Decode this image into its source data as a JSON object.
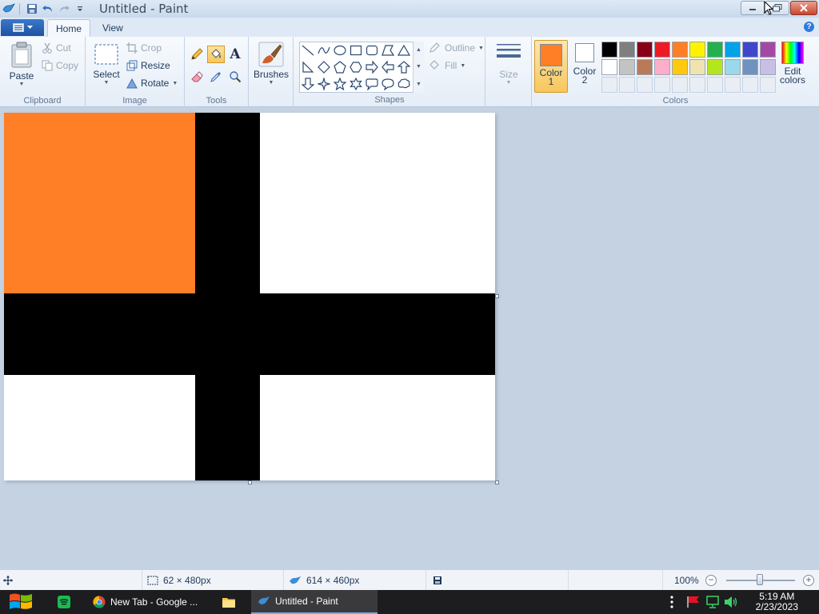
{
  "window": {
    "title": "Untitled - Paint"
  },
  "tabs": {
    "home": "Home",
    "view": "View"
  },
  "clipboard": {
    "paste": "Paste",
    "cut": "Cut",
    "copy": "Copy",
    "group_label": "Clipboard"
  },
  "image": {
    "select": "Select",
    "crop": "Crop",
    "resize": "Resize",
    "rotate": "Rotate",
    "group_label": "Image"
  },
  "tools": {
    "group_label": "Tools",
    "active_tool": "fill-with-color"
  },
  "brushes": {
    "label": "Brushes"
  },
  "shapes": {
    "outline": "Outline",
    "fill": "Fill",
    "group_label": "Shapes"
  },
  "size": {
    "label": "Size"
  },
  "colors": {
    "color1_label_line1": "Color",
    "color1_label_line2": "1",
    "color2_label_line1": "Color",
    "color2_label_line2": "2",
    "color1_value": "#ff7f27",
    "color2_value": "#ffffff",
    "edit_line1": "Edit",
    "edit_line2": "colors",
    "group_label": "Colors",
    "palette_row1": [
      "#000000",
      "#7f7f7f",
      "#880015",
      "#ed1c24",
      "#ff7f27",
      "#fff200",
      "#22b14c",
      "#00a2e8",
      "#3f48cc",
      "#a349a4"
    ],
    "palette_row2": [
      "#ffffff",
      "#c3c3c3",
      "#b97a57",
      "#ffaec9",
      "#ffc90e",
      "#efe4b0",
      "#b5e61d",
      "#99d9ea",
      "#7092be",
      "#c8bfe7"
    ]
  },
  "canvas_colors": {
    "orange": "#ff7f27",
    "black": "#000000",
    "white": "#ffffff"
  },
  "statusbar": {
    "selection_size": "62 × 480px",
    "image_size": "614 × 460px",
    "zoom": "100%"
  },
  "taskbar": {
    "chrome_label": "New Tab - Google ...",
    "paint_label": "Untitled - Paint",
    "time": "5:19 AM",
    "date": "2/23/2023"
  }
}
